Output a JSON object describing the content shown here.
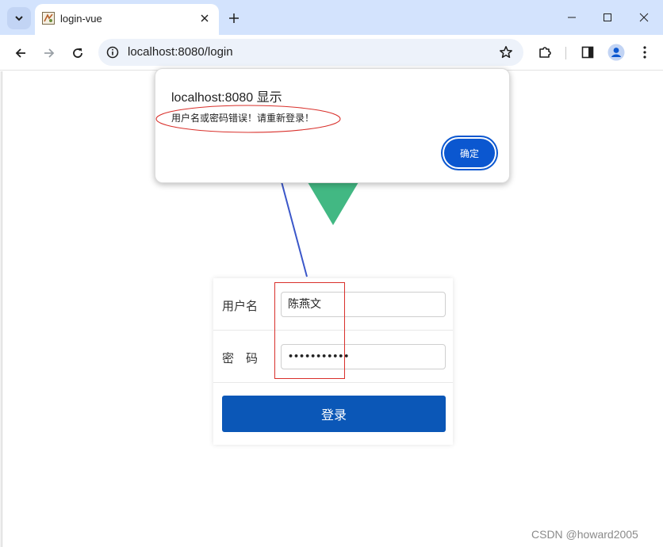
{
  "browser": {
    "tab_title": "login-vue",
    "url": "localhost:8080/login"
  },
  "dialog": {
    "title": "localhost:8080 显示",
    "message": "用户名或密码错误！请重新登录！",
    "ok_label": "确定"
  },
  "login_form": {
    "username_label": "用户名",
    "username_value": "陈燕文",
    "password_label": "密　码",
    "password_value": "•••••••••••",
    "submit_label": "登录"
  },
  "colors": {
    "primary_button": "#0b57b7",
    "dialog_button": "#0b57d0",
    "vue_green": "#42b883",
    "annotation_red": "#d9302b",
    "annotation_arrow": "#3b57c9"
  },
  "watermark": "CSDN @howard2005"
}
